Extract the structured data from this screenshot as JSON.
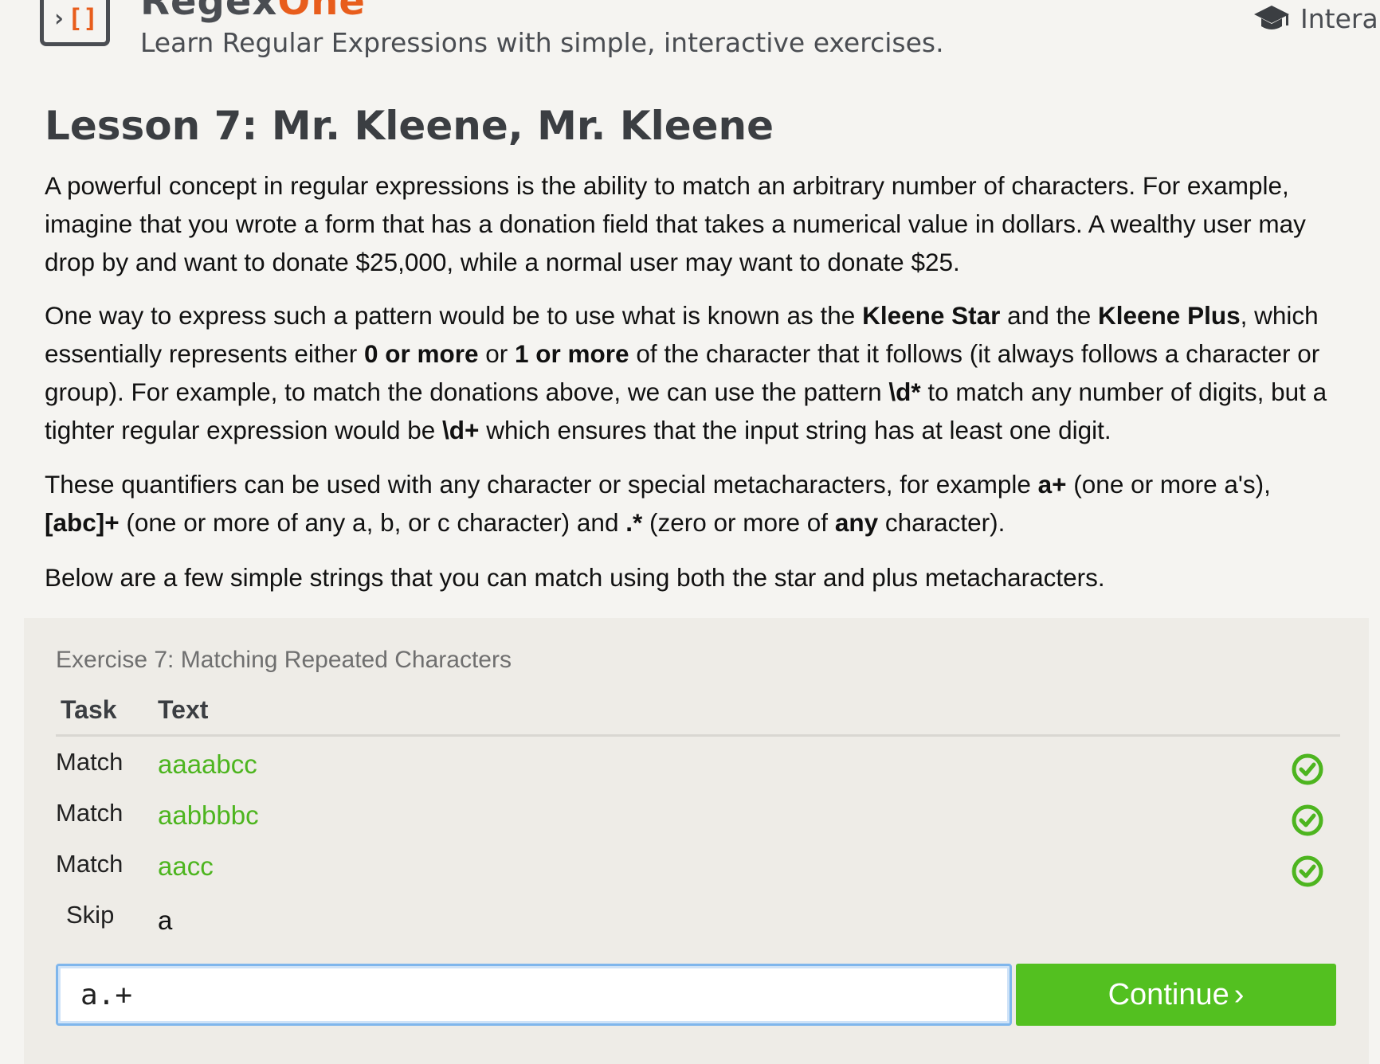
{
  "header": {
    "logo_chevron": "›",
    "logo_brackets": "[]",
    "brand_part1": "Regex",
    "brand_part2": "One",
    "tagline": "Learn Regular Expressions with simple, interactive exercises.",
    "nav_label": "Intera",
    "nav_icon": "graduation-cap-icon"
  },
  "lesson": {
    "title": "Lesson 7: Mr. Kleene, Mr. Kleene",
    "p1": "A powerful concept in regular expressions is the ability to match an arbitrary number of characters. For example, imagine that you wrote a form that has a donation field that takes a numerical value in dollars. A wealthy user may drop by and want to donate $25,000, while a normal user may want to donate $25.",
    "p2": {
      "t1": "One way to express such a pattern would be to use what is known as the ",
      "b1": "Kleene Star",
      "t2": " and the ",
      "b2": "Kleene Plus",
      "t3": ", which essentially represents either ",
      "b3": "0 or more",
      "t4": " or ",
      "b4": "1 or more",
      "t5": " of the character that it follows (it always follows a character or group). For example, to match the donations above, we can use the pattern ",
      "b5": "\\d*",
      "t6": " to match any number of digits, but a tighter regular expression would be ",
      "b6": "\\d+",
      "t7": " which ensures that the input string has at least one digit."
    },
    "p3": {
      "t1": "These quantifiers can be used with any character or special metacharacters, for example ",
      "b1": "a+",
      "t2": " (one or more a's), ",
      "b2": "[abc]+",
      "t3": " (one or more of any a, b, or c character) and ",
      "b3": ".*",
      "t4": " (zero or more of ",
      "b4": "any",
      "t5": " character)."
    },
    "p4": "Below are a few simple strings that you can match using both the star and plus metacharacters."
  },
  "exercise": {
    "title": "Exercise 7: Matching Repeated Characters",
    "col_task": "Task",
    "col_text": "Text",
    "rows": [
      {
        "task": "Match",
        "text": "aaaabcc",
        "status": "check-circle-icon"
      },
      {
        "task": "Match",
        "text": "aabbbbc",
        "status": "check-circle-icon"
      },
      {
        "task": "Match",
        "text": "aacc",
        "status": "check-circle-icon"
      },
      {
        "task": "Skip",
        "text": "a",
        "status": ""
      }
    ],
    "input_value": "a.+",
    "continue_label": "Continue",
    "continue_icon": "›"
  },
  "colors": {
    "brand_orange": "#e85d1c",
    "match_green": "#4db51f",
    "continue_green": "#53c020",
    "input_focus_blue": "#7fb6ec"
  }
}
